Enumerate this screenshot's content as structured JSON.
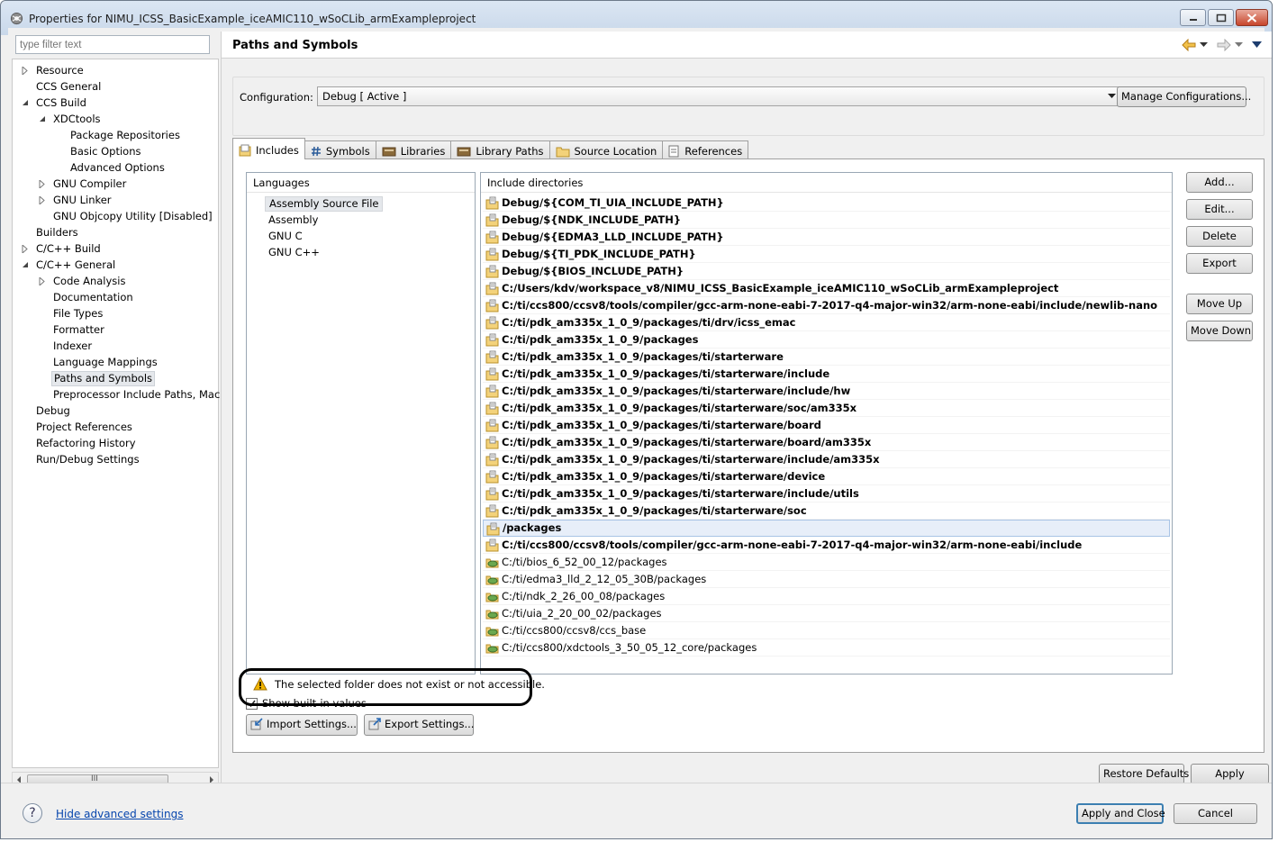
{
  "window": {
    "title": "Properties for NIMU_ICSS_BasicExample_iceAMIC110_wSoCLib_armExampleproject"
  },
  "nav": {
    "filter_placeholder": "type filter text",
    "hscroll_grip": "III",
    "items": [
      {
        "label": "Resource",
        "depth": 0,
        "twisty": "closed"
      },
      {
        "label": "CCS General",
        "depth": 0,
        "twisty": "none"
      },
      {
        "label": "CCS Build",
        "depth": 0,
        "twisty": "open"
      },
      {
        "label": "XDCtools",
        "depth": 1,
        "twisty": "open"
      },
      {
        "label": "Package Repositories",
        "depth": 2,
        "twisty": "none"
      },
      {
        "label": "Basic Options",
        "depth": 2,
        "twisty": "none"
      },
      {
        "label": "Advanced Options",
        "depth": 2,
        "twisty": "none"
      },
      {
        "label": "GNU Compiler",
        "depth": 1,
        "twisty": "closed"
      },
      {
        "label": "GNU Linker",
        "depth": 1,
        "twisty": "closed"
      },
      {
        "label": "GNU Objcopy Utility  [Disabled]",
        "depth": 1,
        "twisty": "none"
      },
      {
        "label": "Builders",
        "depth": 0,
        "twisty": "none"
      },
      {
        "label": "C/C++ Build",
        "depth": 0,
        "twisty": "closed"
      },
      {
        "label": "C/C++ General",
        "depth": 0,
        "twisty": "open"
      },
      {
        "label": "Code Analysis",
        "depth": 1,
        "twisty": "closed"
      },
      {
        "label": "Documentation",
        "depth": 1,
        "twisty": "none"
      },
      {
        "label": "File Types",
        "depth": 1,
        "twisty": "none"
      },
      {
        "label": "Formatter",
        "depth": 1,
        "twisty": "none"
      },
      {
        "label": "Indexer",
        "depth": 1,
        "twisty": "none"
      },
      {
        "label": "Language Mappings",
        "depth": 1,
        "twisty": "none"
      },
      {
        "label": "Paths and Symbols",
        "depth": 1,
        "twisty": "none",
        "selected": true
      },
      {
        "label": "Preprocessor Include Paths, Macı",
        "depth": 1,
        "twisty": "none"
      },
      {
        "label": "Debug",
        "depth": 0,
        "twisty": "none"
      },
      {
        "label": "Project References",
        "depth": 0,
        "twisty": "none"
      },
      {
        "label": "Refactoring History",
        "depth": 0,
        "twisty": "none"
      },
      {
        "label": "Run/Debug Settings",
        "depth": 0,
        "twisty": "none"
      }
    ]
  },
  "page": {
    "title": "Paths and Symbols"
  },
  "config": {
    "label": "Configuration:",
    "value": "Debug  [ Active ]",
    "manage_label": "Manage Configurations..."
  },
  "tabs": [
    {
      "label": "Includes",
      "icon": "includes-icon",
      "active": true
    },
    {
      "label": "Symbols",
      "icon": "hash-icon"
    },
    {
      "label": "Libraries",
      "icon": "library-icon"
    },
    {
      "label": "Library Paths",
      "icon": "library-path-icon"
    },
    {
      "label": "Source Location",
      "icon": "folder-icon"
    },
    {
      "label": "References",
      "icon": "references-icon"
    }
  ],
  "languages": {
    "header": "Languages",
    "items": [
      {
        "label": "Assembly Source File",
        "selected": true
      },
      {
        "label": "Assembly"
      },
      {
        "label": "GNU C"
      },
      {
        "label": "GNU C++"
      }
    ]
  },
  "includes": {
    "header": "Include directories",
    "rows": [
      {
        "path": "Debug/${COM_TI_UIA_INCLUDE_PATH}",
        "bold": true,
        "icon": "include-folder-icon"
      },
      {
        "path": "Debug/${NDK_INCLUDE_PATH}",
        "bold": true,
        "icon": "include-folder-icon"
      },
      {
        "path": "Debug/${EDMA3_LLD_INCLUDE_PATH}",
        "bold": true,
        "icon": "include-folder-icon"
      },
      {
        "path": "Debug/${TI_PDK_INCLUDE_PATH}",
        "bold": true,
        "icon": "include-folder-icon"
      },
      {
        "path": "Debug/${BIOS_INCLUDE_PATH}",
        "bold": true,
        "icon": "include-folder-icon"
      },
      {
        "path": "C:/Users/kdv/workspace_v8/NIMU_ICSS_BasicExample_iceAMIC110_wSoCLib_armExampleproject",
        "bold": true,
        "icon": "include-folder-icon"
      },
      {
        "path": "C:/ti/ccs800/ccsv8/tools/compiler/gcc-arm-none-eabi-7-2017-q4-major-win32/arm-none-eabi/include/newlib-nano",
        "bold": true,
        "icon": "include-folder-icon"
      },
      {
        "path": "C:/ti/pdk_am335x_1_0_9/packages/ti/drv/icss_emac",
        "bold": true,
        "icon": "include-folder-icon"
      },
      {
        "path": "C:/ti/pdk_am335x_1_0_9/packages",
        "bold": true,
        "icon": "include-folder-icon"
      },
      {
        "path": "C:/ti/pdk_am335x_1_0_9/packages/ti/starterware",
        "bold": true,
        "icon": "include-folder-icon"
      },
      {
        "path": "C:/ti/pdk_am335x_1_0_9/packages/ti/starterware/include",
        "bold": true,
        "icon": "include-folder-icon"
      },
      {
        "path": "C:/ti/pdk_am335x_1_0_9/packages/ti/starterware/include/hw",
        "bold": true,
        "icon": "include-folder-icon"
      },
      {
        "path": "C:/ti/pdk_am335x_1_0_9/packages/ti/starterware/soc/am335x",
        "bold": true,
        "icon": "include-folder-icon"
      },
      {
        "path": "C:/ti/pdk_am335x_1_0_9/packages/ti/starterware/board",
        "bold": true,
        "icon": "include-folder-icon"
      },
      {
        "path": "C:/ti/pdk_am335x_1_0_9/packages/ti/starterware/board/am335x",
        "bold": true,
        "icon": "include-folder-icon"
      },
      {
        "path": "C:/ti/pdk_am335x_1_0_9/packages/ti/starterware/include/am335x",
        "bold": true,
        "icon": "include-folder-icon"
      },
      {
        "path": "C:/ti/pdk_am335x_1_0_9/packages/ti/starterware/device",
        "bold": true,
        "icon": "include-folder-icon"
      },
      {
        "path": "C:/ti/pdk_am335x_1_0_9/packages/ti/starterware/include/utils",
        "bold": true,
        "icon": "include-folder-icon"
      },
      {
        "path": "C:/ti/pdk_am335x_1_0_9/packages/ti/starterware/soc",
        "bold": true,
        "icon": "include-folder-icon"
      },
      {
        "path": "/packages",
        "bold": true,
        "icon": "include-folder-icon",
        "selected": true
      },
      {
        "path": "C:/ti/ccs800/ccsv8/tools/compiler/gcc-arm-none-eabi-7-2017-q4-major-win32/arm-none-eabi/include",
        "bold": true,
        "icon": "include-folder-icon"
      },
      {
        "path": "C:/ti/bios_6_52_00_12/packages",
        "bold": false,
        "icon": "contributed-folder-icon"
      },
      {
        "path": "C:/ti/edma3_lld_2_12_05_30B/packages",
        "bold": false,
        "icon": "contributed-folder-icon"
      },
      {
        "path": "C:/ti/ndk_2_26_00_08/packages",
        "bold": false,
        "icon": "contributed-folder-icon"
      },
      {
        "path": "C:/ti/uia_2_20_00_02/packages",
        "bold": false,
        "icon": "contributed-folder-icon"
      },
      {
        "path": "C:/ti/ccs800/ccsv8/ccs_base",
        "bold": false,
        "icon": "contributed-folder-icon"
      },
      {
        "path": "C:/ti/ccs800/xdctools_3_50_05_12_core/packages",
        "bold": false,
        "icon": "contributed-folder-icon"
      }
    ]
  },
  "side_buttons": {
    "add": "Add...",
    "edit": "Edit...",
    "delete": "Delete",
    "export": "Export",
    "move_up": "Move Up",
    "move_down": "Move Down"
  },
  "warning": {
    "text": "The selected folder does not exist or not accessible."
  },
  "show_builtin": {
    "label": "Show built-in values",
    "checked": true
  },
  "settings_buttons": {
    "import": "Import Settings...",
    "export": "Export Settings..."
  },
  "bottom_buttons": {
    "restore": "Restore Defaults",
    "apply": "Apply"
  },
  "footer": {
    "help": "?",
    "hide_advanced": "Hide advanced settings",
    "apply_close": "Apply and Close",
    "cancel": "Cancel"
  },
  "colors": {
    "link": "#0645ad",
    "selection": "#e7eef9",
    "warning": "#f0b400"
  }
}
